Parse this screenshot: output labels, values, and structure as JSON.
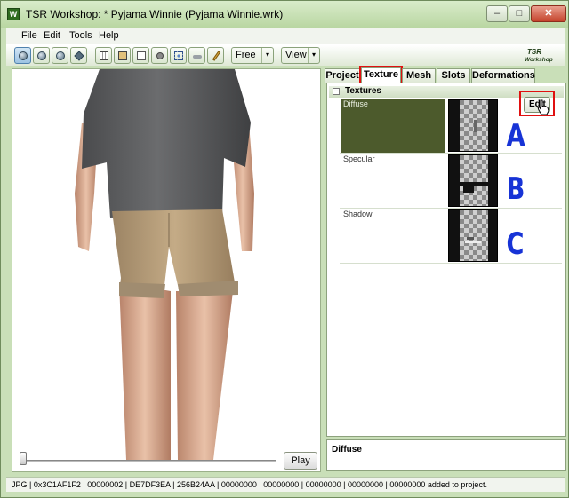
{
  "window": {
    "title": "TSR Workshop: * Pyjama Winnie (Pyjama Winnie.wrk)",
    "app_icon_letter": "W",
    "min_glyph": "–",
    "max_glyph": "□",
    "close_glyph": "✕"
  },
  "menu": [
    "File",
    "Edit",
    "Tools",
    "Help"
  ],
  "toolbar": {
    "camera_mode": "Free",
    "view_label": "View",
    "dropdown_arrow": "▾"
  },
  "logo_text": "TSR Workshop",
  "viewport": {
    "play_label": "Play"
  },
  "tabs": [
    "Project",
    "Texture",
    "Mesh",
    "Slots",
    "Deformations"
  ],
  "textures": {
    "section_title": "Textures",
    "toggle_glyph": "−",
    "edit_label": "Edit",
    "rows": [
      {
        "name": "Diffuse",
        "annotation": "A"
      },
      {
        "name": "Specular",
        "annotation": "B"
      },
      {
        "name": "Shadow",
        "annotation": "C"
      }
    ]
  },
  "description": {
    "title": "Diffuse"
  },
  "status": {
    "text": "JPG | 0x3C1AF1F2 | 00000002 | DE7DF3EA | 256B24AA | 00000000 | 00000000 | 00000000 | 00000000 | 00000000 added to project."
  },
  "colors": {
    "window_bg": "#c9dfb8",
    "selected_row": "#4c5a2c",
    "annotation_blue": "#1733d6",
    "highlight_red": "#e01010"
  }
}
